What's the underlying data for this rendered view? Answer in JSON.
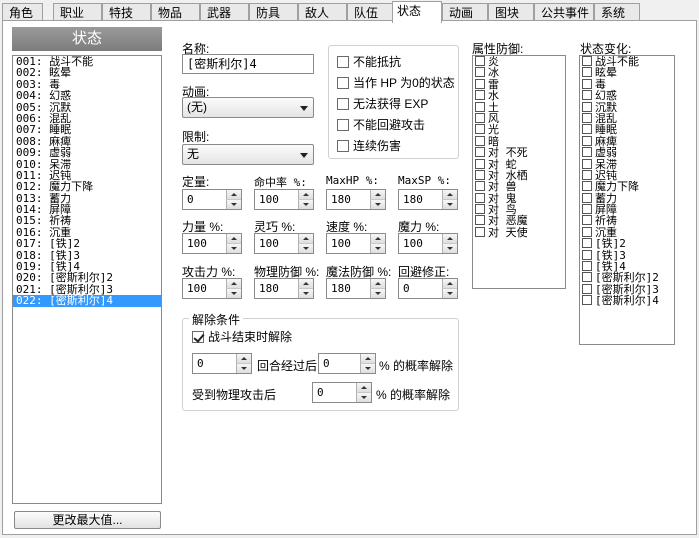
{
  "tabs": [
    "角色",
    "职业",
    "特技",
    "物品",
    "武器",
    "防具",
    "敌人",
    "队伍",
    "状态",
    "动画",
    "图块",
    "公共事件",
    "系统"
  ],
  "active_tab": "状态",
  "list": {
    "header": "状态",
    "items": [
      "001: 战斗不能",
      "002: 眩晕",
      "003: 毒",
      "004: 幻惑",
      "005: 沉默",
      "006: 混乱",
      "007: 睡眠",
      "008: 麻痺",
      "009: 虚弱",
      "010: 呆滞",
      "011: 迟钝",
      "012: 魔力下降",
      "013: 蓄力",
      "014: 屏障",
      "015: 祈祷",
      "016: 沉重",
      "017: [铁]2",
      "018: [铁]3",
      "019: [铁]4",
      "020: [密斯利尔]2",
      "021: [密斯利尔]3",
      "022: [密斯利尔]4"
    ],
    "selected_index": 21,
    "change_max_button": "更改最大值..."
  },
  "form": {
    "name_label": "名称:",
    "name_value": "[密斯利尔]4",
    "animation_label": "动画:",
    "animation_value": "(无)",
    "restriction_label": "限制:",
    "restriction_value": "无",
    "options": [
      {
        "label": "不能抵抗",
        "checked": false
      },
      {
        "label": "当作 HP 为0的状态",
        "checked": false
      },
      {
        "label": "无法获得 EXP",
        "checked": false
      },
      {
        "label": "不能回避攻击",
        "checked": false
      },
      {
        "label": "连续伤害",
        "checked": false
      }
    ],
    "stats_row1": [
      {
        "label": "定量:",
        "value": "0"
      },
      {
        "label": "命中率 %:",
        "value": "100"
      },
      {
        "label": "MaxHP %:",
        "value": "180"
      },
      {
        "label": "MaxSP %:",
        "value": "180"
      }
    ],
    "stats_row2": [
      {
        "label": "力量 %:",
        "value": "100"
      },
      {
        "label": "灵巧 %:",
        "value": "100"
      },
      {
        "label": "速度 %:",
        "value": "100"
      },
      {
        "label": "魔力 %:",
        "value": "100"
      }
    ],
    "stats_row3": [
      {
        "label": "攻击力 %:",
        "value": "100"
      },
      {
        "label": "物理防御 %:",
        "value": "180"
      },
      {
        "label": "魔法防御 %:",
        "value": "180"
      },
      {
        "label": "回避修正:",
        "value": "0"
      }
    ],
    "release": {
      "title": "解除条件",
      "battle_end_label": "战斗结束时解除",
      "battle_end_checked": true,
      "turns_value": "0",
      "turns_label": "回合经过后",
      "turns_pct_value": "0",
      "turns_pct_label": "% 的概率解除",
      "phys_label": "受到物理攻击后",
      "phys_pct_value": "0",
      "phys_pct_label": "% 的概率解除"
    }
  },
  "element_defense": {
    "title": "属性防御:",
    "items": [
      "炎",
      "冰",
      "雷",
      "水",
      "土",
      "风",
      "光",
      "暗",
      "对 不死",
      "对 蛇",
      "对 水栖",
      "对 兽",
      "对 鬼",
      "对 鸟",
      "对 恶魔",
      "对 天使"
    ]
  },
  "state_change": {
    "title": "状态变化:",
    "items": [
      "战斗不能",
      "眩晕",
      "毒",
      "幻惑",
      "沉默",
      "混乱",
      "睡眠",
      "麻痺",
      "虚弱",
      "呆滞",
      "迟钝",
      "魔力下降",
      "蓄力",
      "屏障",
      "祈祷",
      "沉重",
      "[铁]2",
      "[铁]3",
      "[铁]4",
      "[密斯利尔]2",
      "[密斯利尔]3",
      "[密斯利尔]4"
    ]
  },
  "colors": {
    "selection": "#3399ff",
    "header_gray": "#8a8a8a"
  }
}
